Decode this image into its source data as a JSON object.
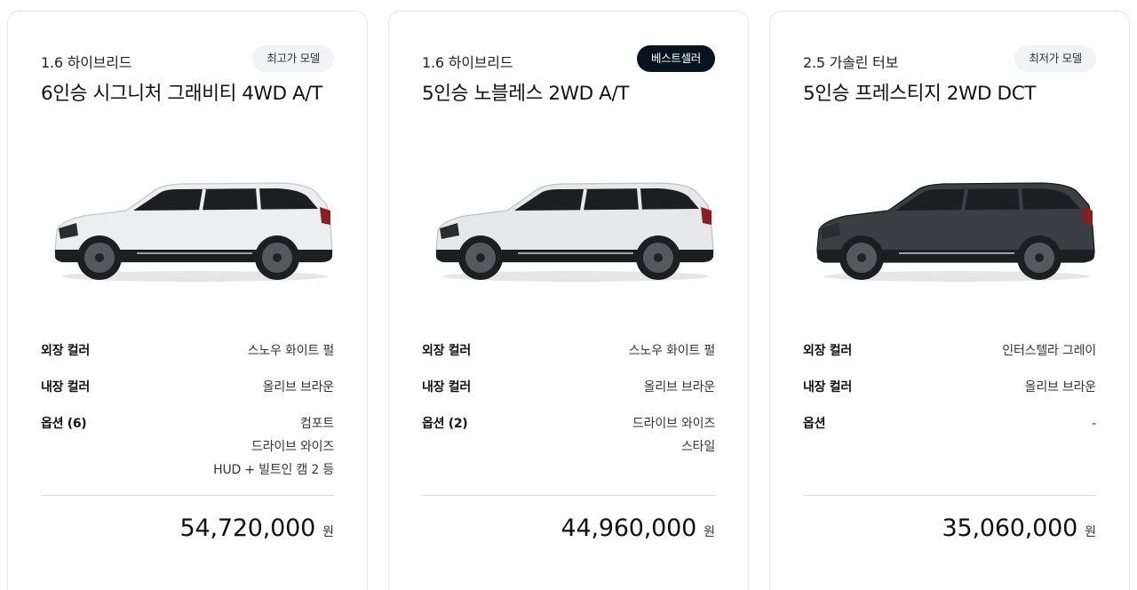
{
  "cards": [
    {
      "trim": "1.6 하이브리드",
      "badge": "최고가 모델",
      "model": "6인승 시그니처 그래비티 4WD A/T",
      "car_color": "#eceeef",
      "car_icon": "white-suv",
      "exterior_label": "외장 컬러",
      "exterior_value": "스노우 화이트 펄",
      "interior_label": "내장 컬러",
      "interior_value": "올리브 브라운",
      "options_label": "옵션 (6)",
      "options": [
        "컴포트",
        "드라이브 와이즈",
        "HUD + 빌트인 캠 2 등"
      ],
      "price": "54,720,000",
      "currency": "원"
    },
    {
      "trim": "1.6 하이브리드",
      "badge": "베스트셀러",
      "model": "5인승 노블레스 2WD A/T",
      "car_color": "#e6e8ea",
      "car_icon": "white-suv",
      "exterior_label": "외장 컬러",
      "exterior_value": "스노우 화이트 펄",
      "interior_label": "내장 컬러",
      "interior_value": "올리브 브라운",
      "options_label": "옵션 (2)",
      "options": [
        "드라이브 와이즈",
        "스타일"
      ],
      "price": "44,960,000",
      "currency": "원"
    },
    {
      "trim": "2.5 가솔린 터보",
      "badge": "최저가 모델",
      "model": "5인승 프레스티지 2WD DCT",
      "car_color": "#3b3f44",
      "car_icon": "dark-gray-suv",
      "exterior_label": "외장 컬러",
      "exterior_value": "인터스텔라 그레이",
      "interior_label": "내장 컬러",
      "interior_value": "올리브 브라운",
      "options_label": "옵션",
      "options": [
        "-"
      ],
      "price": "35,060,000",
      "currency": "원"
    }
  ],
  "colors": {
    "badge_dark_bg": "#05141f",
    "badge_light_bg": "#f2f3f5"
  }
}
